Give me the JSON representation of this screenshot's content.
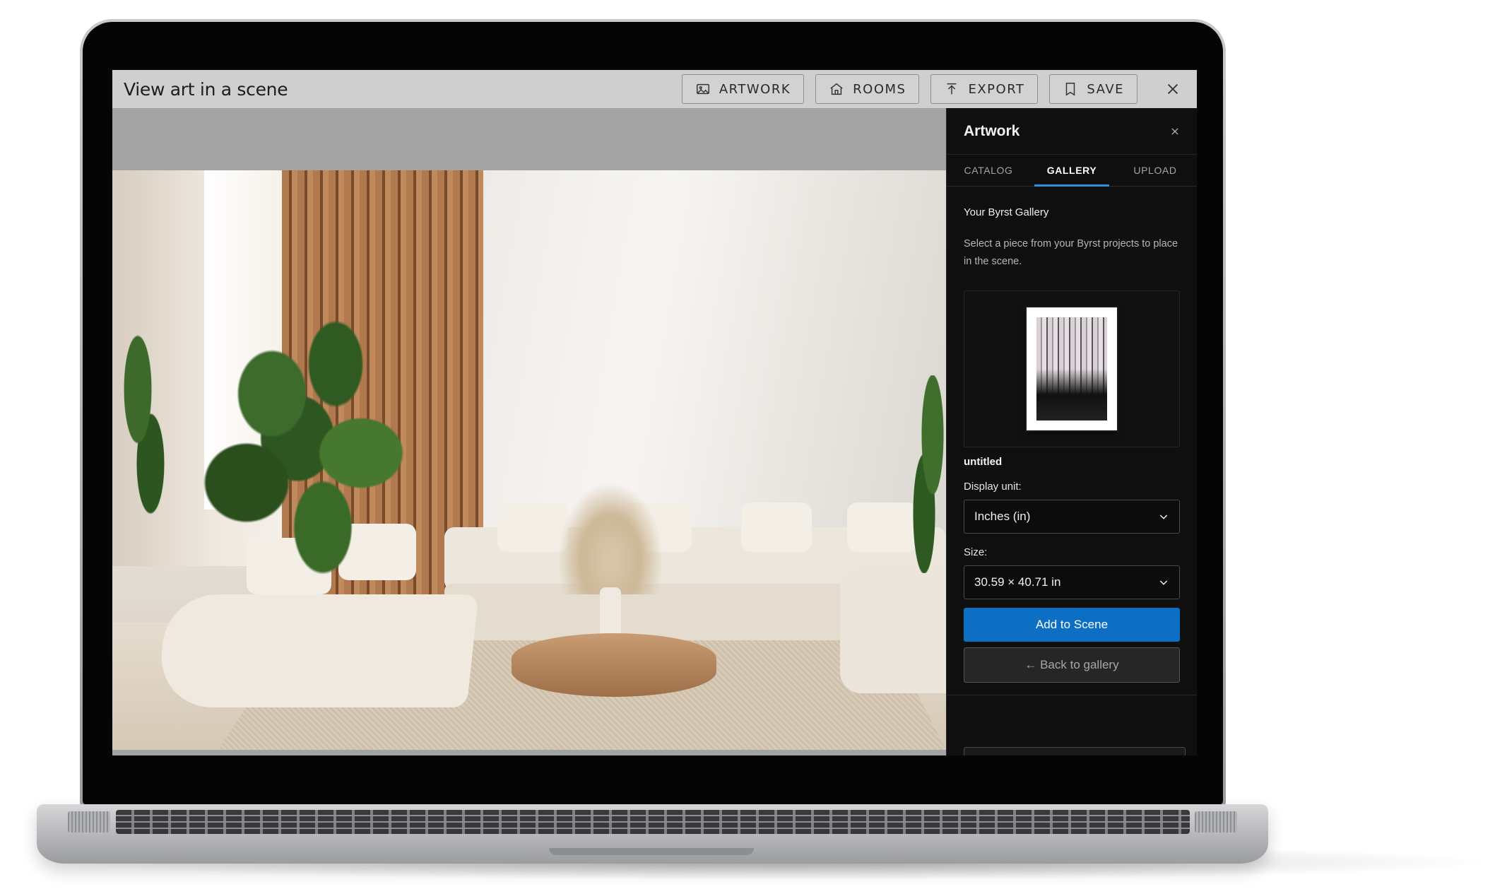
{
  "app": {
    "title": "View art in a scene"
  },
  "toolbar": {
    "buttons": [
      {
        "label": "ARTWORK",
        "icon": "image-icon"
      },
      {
        "label": "ROOMS",
        "icon": "home-icon"
      },
      {
        "label": "EXPORT",
        "icon": "upload-icon"
      },
      {
        "label": "SAVE",
        "icon": "bookmark-icon"
      }
    ],
    "close_icon": "close-icon"
  },
  "panel": {
    "title": "Artwork",
    "close_icon": "close-icon",
    "tabs": [
      {
        "label": "CATALOG",
        "active": false
      },
      {
        "label": "GALLERY",
        "active": true
      },
      {
        "label": "UPLOAD",
        "active": false
      }
    ],
    "section_title": "Your Byrst Gallery",
    "section_desc": "Select a piece from your Byrst projects to place in the scene.",
    "artwork_name": "untitled",
    "display_unit_label": "Display unit:",
    "display_unit_value": "Inches (in)",
    "size_label": "Size:",
    "size_value": "30.59 × 40.71 in",
    "add_button": "Add to Scene",
    "back_button": "← Back to gallery"
  },
  "colors": {
    "accent": "#0d6fc4",
    "tab_underline": "#2c8ce0",
    "titlebar": "#cfcfcf",
    "panel_bg": "#0f0f0f"
  }
}
